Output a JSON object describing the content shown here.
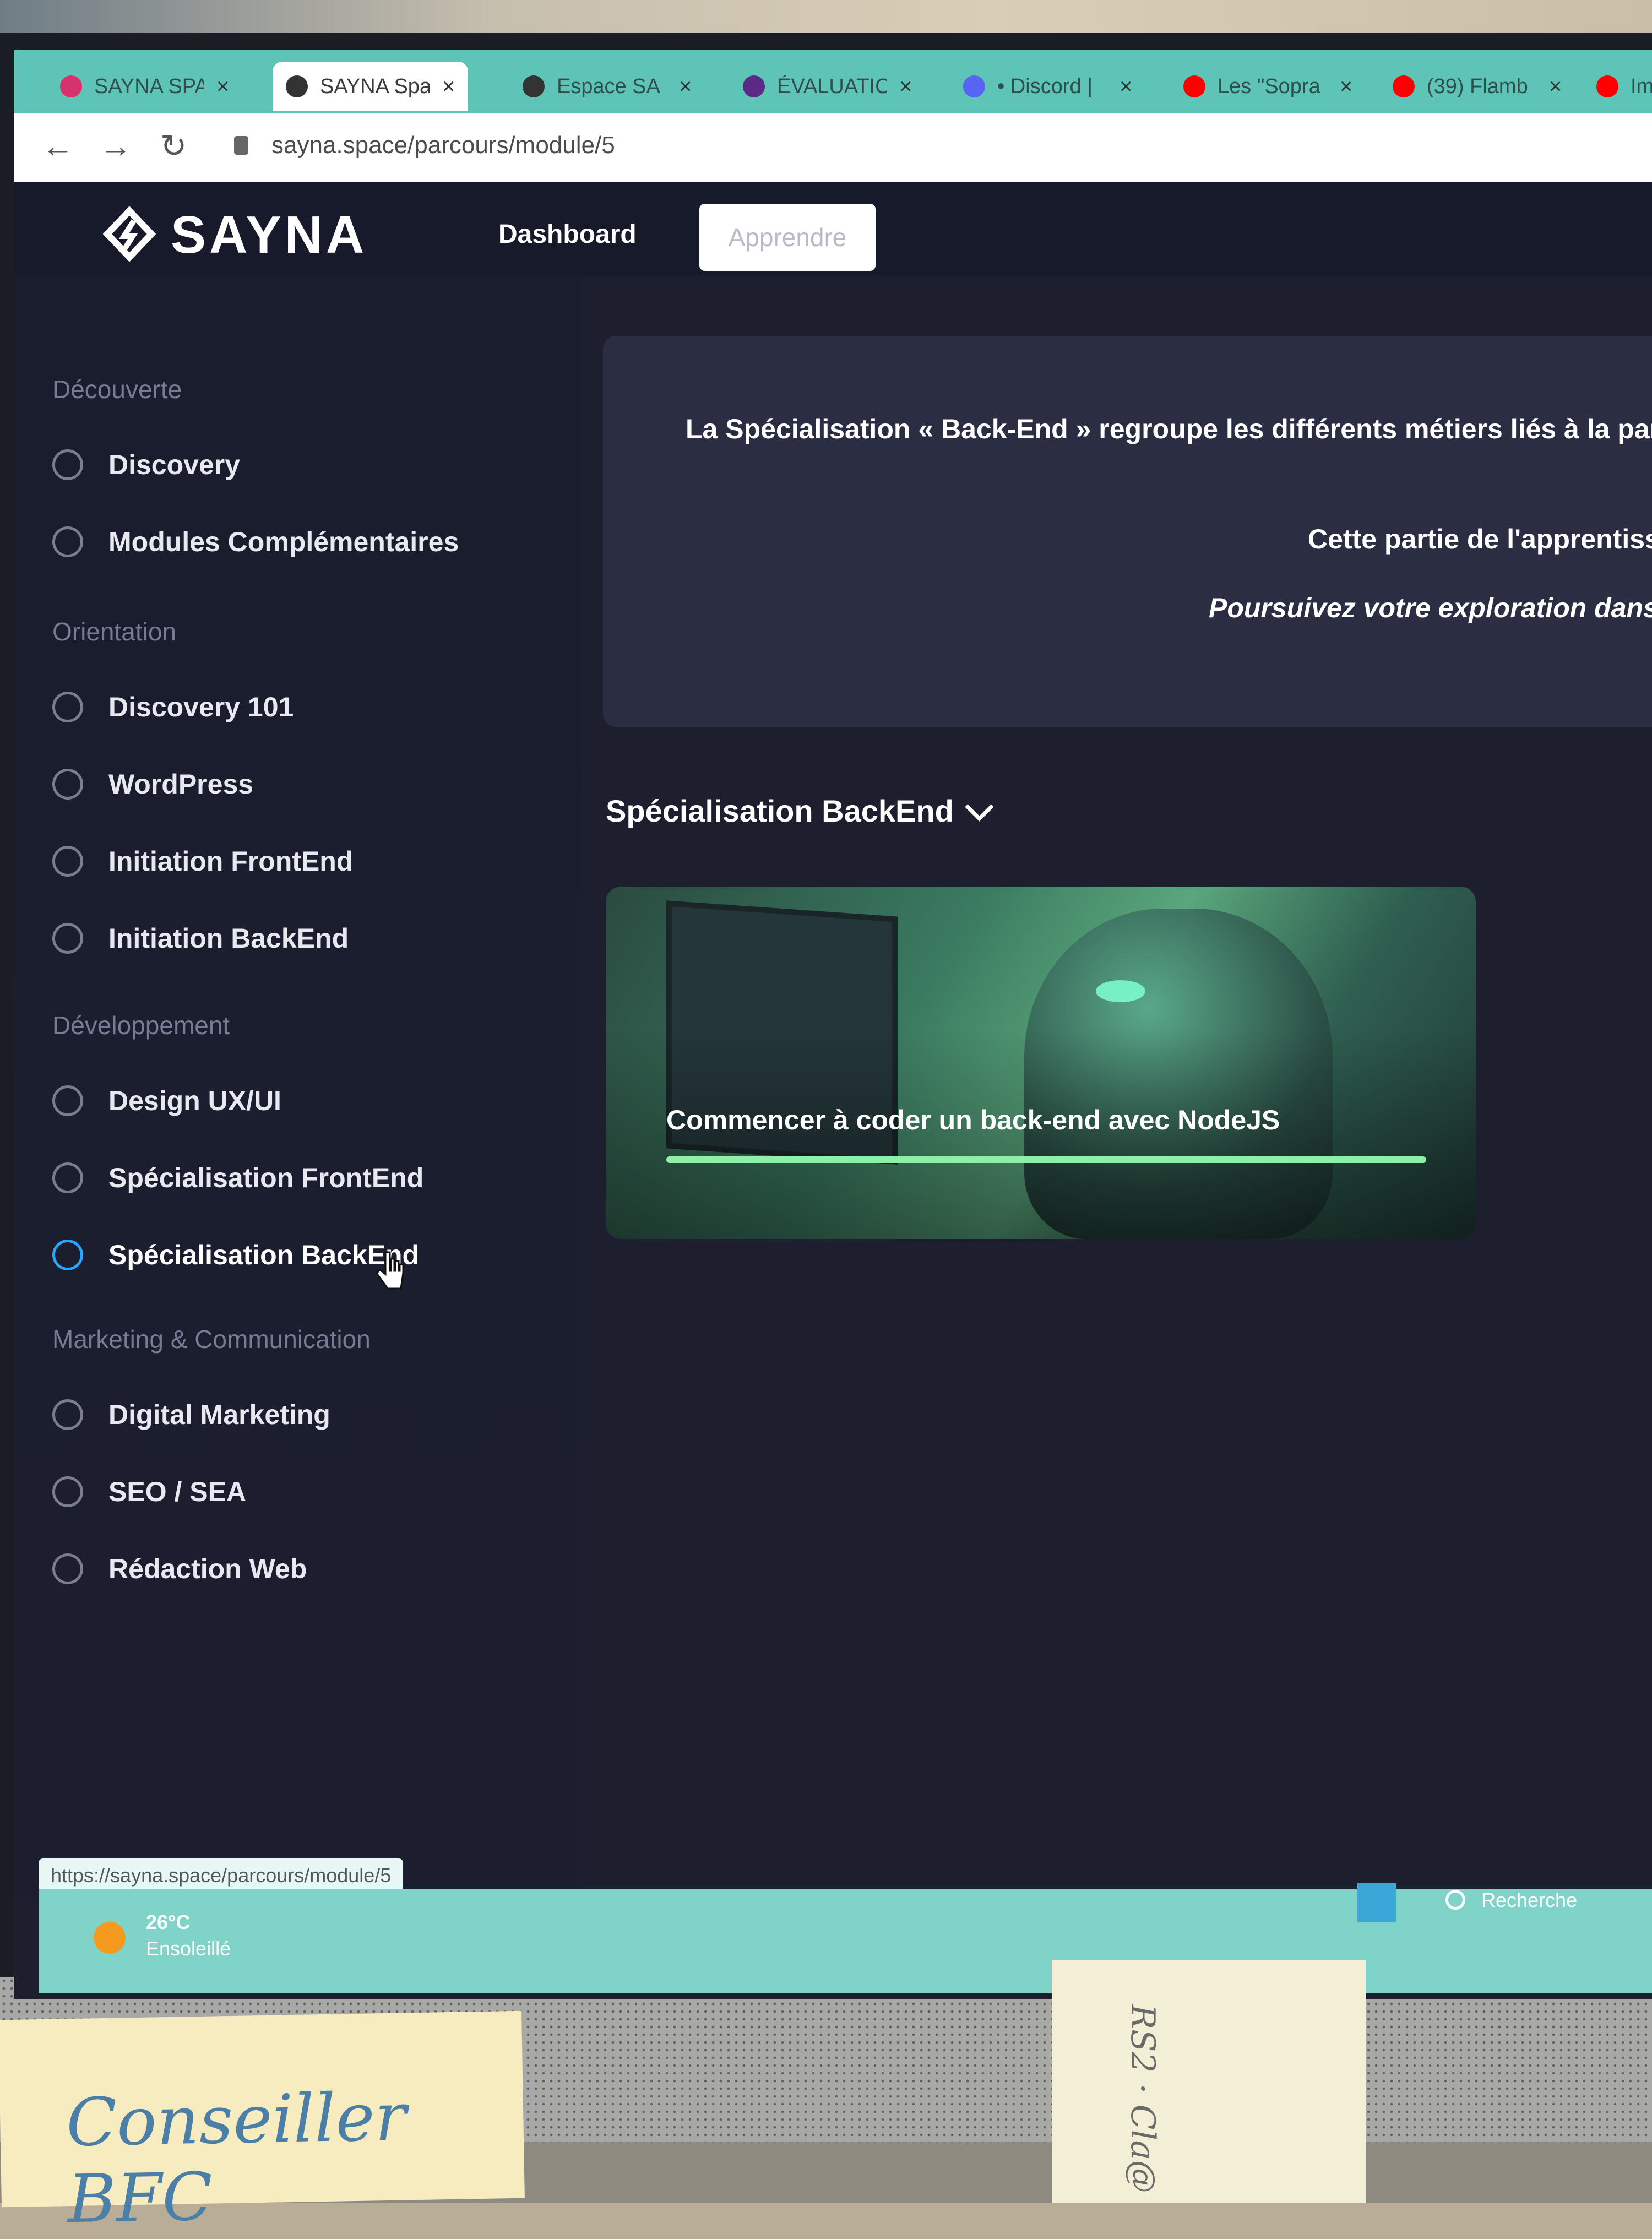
{
  "browser": {
    "tabs": [
      {
        "title": "SAYNA SPA",
        "active": false,
        "favicon_color": "#d6336c"
      },
      {
        "title": "SAYNA Spa",
        "active": true,
        "favicon_color": "#333333"
      },
      {
        "title": "Espace SA",
        "active": false,
        "favicon_color": "#333333"
      },
      {
        "title": "ÉVALUATIC",
        "active": false,
        "favicon_color": "#5b2a86"
      },
      {
        "title": "• Discord |",
        "active": false,
        "favicon_color": "#5865f2"
      },
      {
        "title": "Les \"Sopra",
        "active": false,
        "favicon_color": "#ff0000"
      },
      {
        "title": "(39) Flamb",
        "active": false,
        "favicon_color": "#ff0000"
      },
      {
        "title": "Ima",
        "active": false,
        "favicon_color": "#ff0000"
      }
    ],
    "tab_close": "×",
    "back": "←",
    "forward": "→",
    "reload": "↻",
    "url": "sayna.space/parcours/module/5",
    "status_url": "https://sayna.space/parcours/module/5"
  },
  "header": {
    "brand": "SAYNA",
    "nav": {
      "dashboard": "Dashboard",
      "apprendre": "Apprendre"
    }
  },
  "sidebar": {
    "sections": [
      {
        "title": "Découverte",
        "items": [
          "Discovery",
          "Modules Complémentaires"
        ]
      },
      {
        "title": "Orientation",
        "items": [
          "Discovery 101",
          "WordPress",
          "Initiation FrontEnd",
          "Initiation BackEnd"
        ]
      },
      {
        "title": "Développement",
        "items": [
          "Design UX/UI",
          "Spécialisation FrontEnd",
          "Spécialisation BackEnd"
        ]
      },
      {
        "title": "Marketing & Communication",
        "items": [
          "Digital Marketing",
          "SEO / SEA",
          "Rédaction Web"
        ]
      }
    ],
    "selected": "Spécialisation BackEnd",
    "accent": "#2aa6ff"
  },
  "main": {
    "intro": {
      "p1": "La Spécialisation « Back-End » regroupe les différents métiers liés à la partie « invi",
      "p2": "Cette partie de l'apprentissag",
      "p3": "Poursuivez votre exploration dans ce"
    },
    "section_select": "Spécialisation BackEnd",
    "course": {
      "title": "Commencer à coder un back-end avec NodeJS",
      "progress": 1.0,
      "progress_color": "#8ef0a6"
    }
  },
  "taskbar": {
    "weather_temp": "26°C",
    "weather_desc": "Ensoleillé",
    "search": "Recherche"
  },
  "notes": {
    "left": "Conseiller BFC",
    "right": "RS2 · Cla@"
  }
}
